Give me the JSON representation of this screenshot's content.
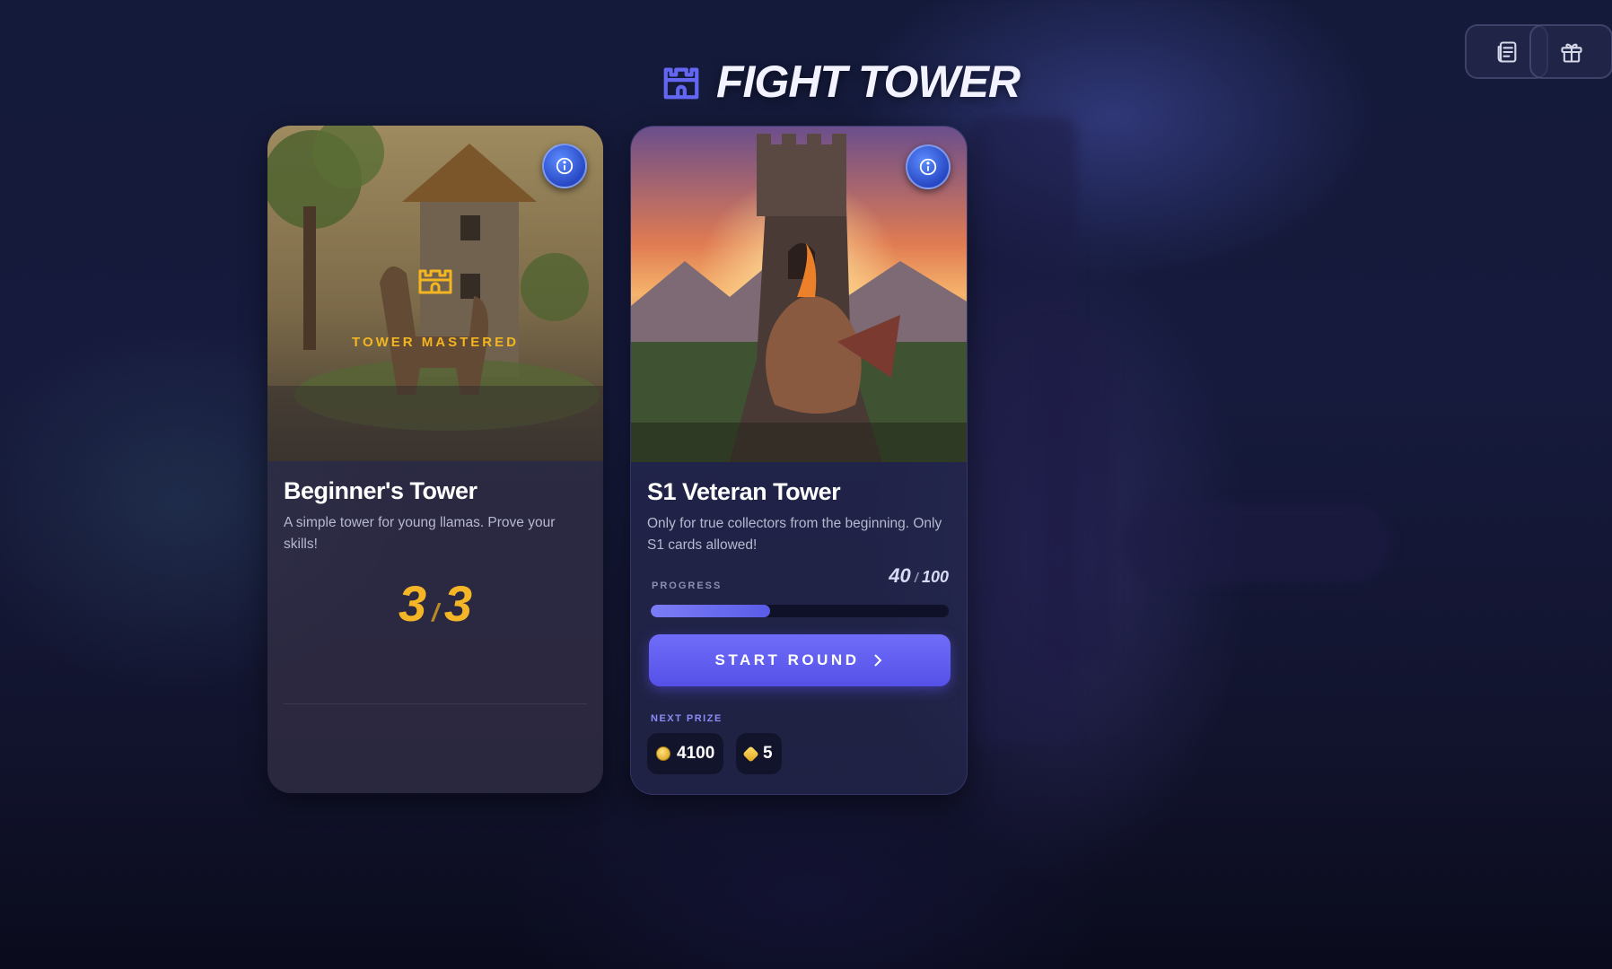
{
  "header": {
    "title": "FIGHT TOWER",
    "icon": "castle-icon",
    "accent_color": "#6266f1"
  },
  "top_buttons": [
    {
      "icon": "news-icon"
    },
    {
      "icon": "gift-icon"
    }
  ],
  "towers": [
    {
      "title": "Beginner's Tower",
      "description": "A simple tower for young llamas. Prove your skills!",
      "status_label": "TOWER MASTERED",
      "score_current": "3",
      "score_max": "3",
      "art": "llama-tower-art"
    },
    {
      "title": "S1 Veteran Tower",
      "description": "Only for true collectors from the beginning. Only S1 cards allowed!",
      "progress_label": "PROGRESS",
      "progress_current": "40",
      "progress_max": "100",
      "progress_fraction": 0.4,
      "start_label": "START ROUND",
      "next_prize_label": "NEXT PRIZE",
      "prizes": [
        {
          "icon": "coin-icon",
          "value": "4100"
        },
        {
          "icon": "gem-icon",
          "value": "5"
        }
      ],
      "art": "dragon-tower-art"
    }
  ]
}
